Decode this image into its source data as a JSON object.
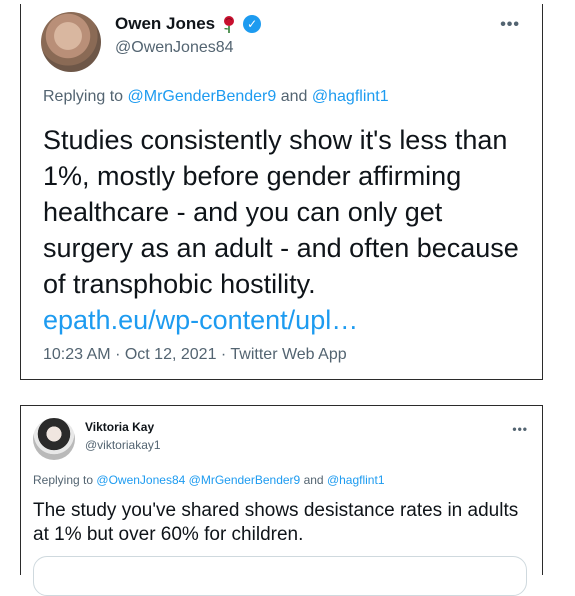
{
  "tweet1": {
    "author_name": "Owen Jones",
    "handle": "@OwenJones84",
    "more_label": "•••",
    "replying_prefix": "Replying to",
    "reply_to_1": "@MrGenderBender9",
    "reply_and": "and",
    "reply_to_2": "@hagflint1",
    "text": "Studies consistently show it's less than 1%, mostly before gender affirming healthcare - and you can only get surgery as an adult - and often because of transphobic hostility.",
    "link": "epath.eu/wp-content/upl…",
    "time": "10:23 AM",
    "date": "Oct 12, 2021",
    "source": "Twitter Web App",
    "sep": "·"
  },
  "tweet2": {
    "author_name": "Viktoria Kay",
    "handle": "@viktoriakay1",
    "more_label": "•••",
    "replying_prefix": "Replying to",
    "reply_to_1": "@OwenJones84",
    "reply_to_2": "@MrGenderBender9",
    "reply_and": "and",
    "reply_to_3": "@hagflint1",
    "text": "The study you've shared shows desistance rates in adults at 1% but over 60% for children."
  },
  "colors": {
    "text": "#0f1419",
    "secondary": "#536471",
    "link": "#1d9bf0",
    "verified": "#1d9bf0",
    "rose": "#c8102e"
  },
  "icons": [
    "rose-emoji-icon",
    "verified-badge-icon",
    "more-options-icon"
  ]
}
